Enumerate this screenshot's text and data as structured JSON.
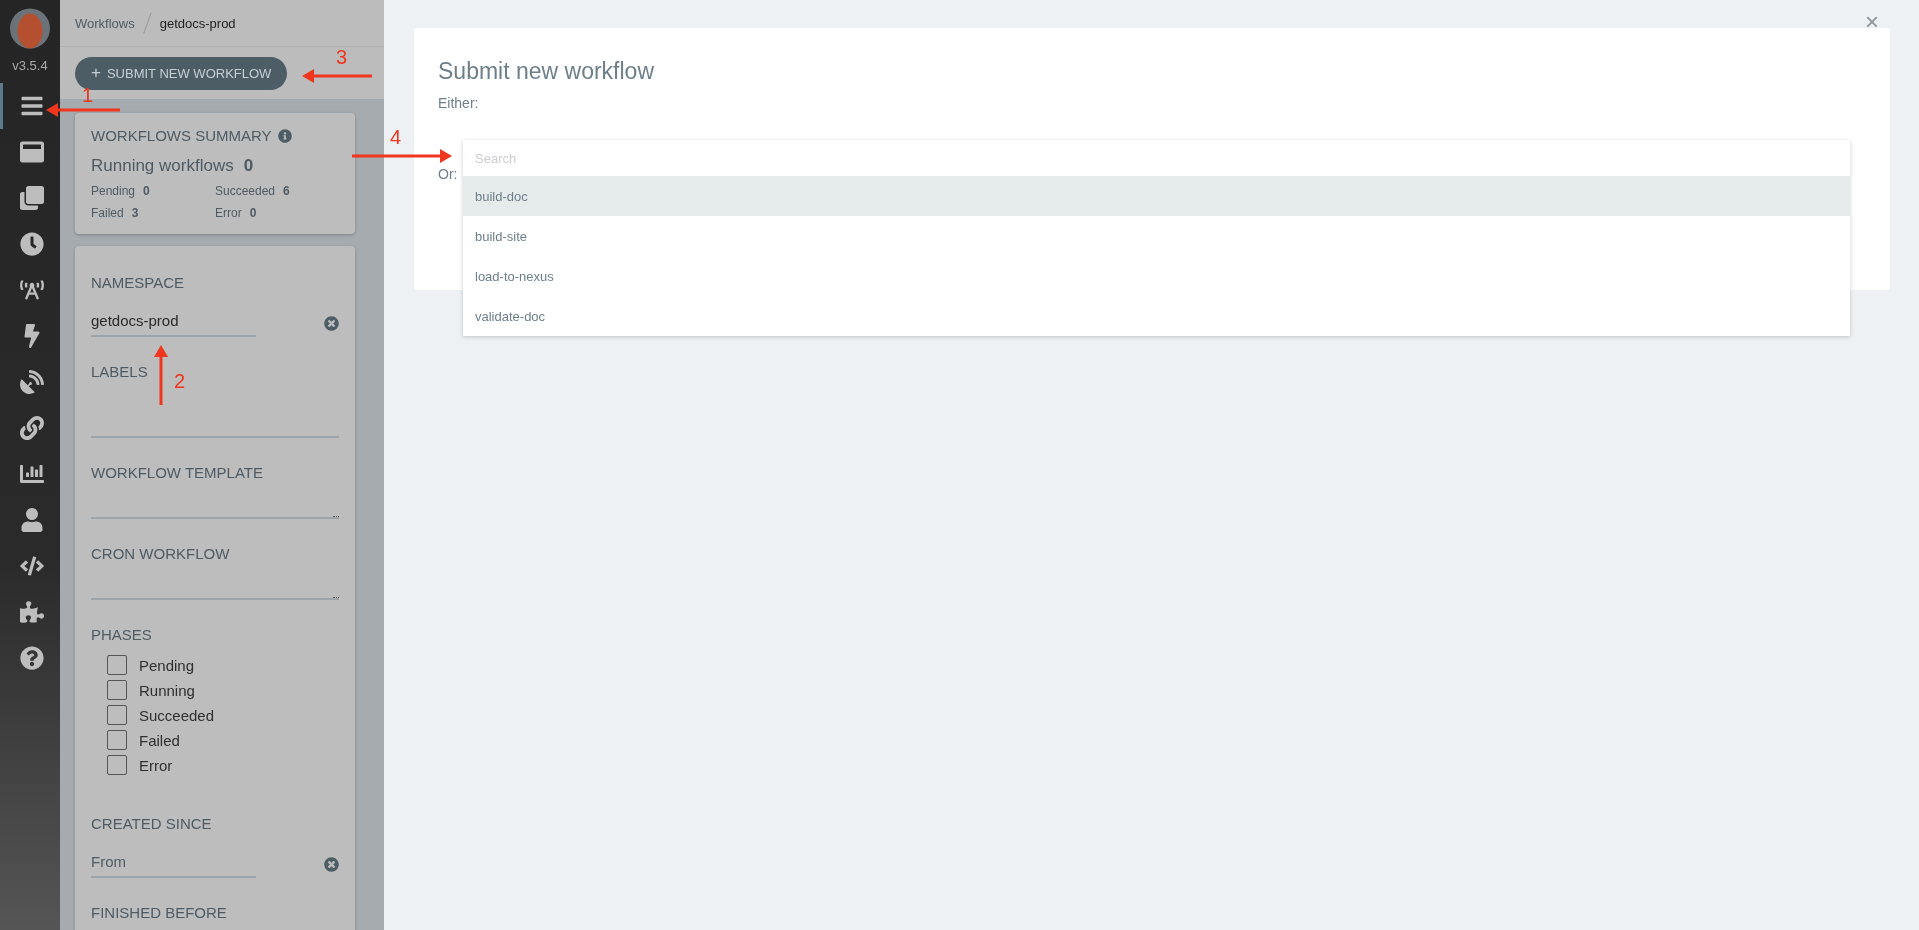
{
  "sidebar": {
    "version": "v3.5.4",
    "items": [
      {
        "selected": true
      },
      {
        "selected": false
      },
      {
        "selected": false
      },
      {
        "selected": false
      },
      {
        "selected": false
      },
      {
        "selected": false
      },
      {
        "selected": false
      },
      {
        "selected": false
      },
      {
        "selected": false
      },
      {
        "selected": false
      },
      {
        "selected": false
      },
      {
        "selected": false
      },
      {
        "selected": false
      }
    ]
  },
  "breadcrumb": [
    "Workflows",
    "getdocs-prod"
  ],
  "submit_button": {
    "icon": "+",
    "label": "SUBMIT NEW WORKFLOW"
  },
  "summary": {
    "title": "WORKFLOWS SUMMARY",
    "running_label": "Running workflows",
    "running_count": "0",
    "stats": [
      {
        "label": "Pending",
        "value": "0"
      },
      {
        "label": "Succeeded",
        "value": "6"
      },
      {
        "label": "Failed",
        "value": "3"
      },
      {
        "label": "Error",
        "value": "0"
      }
    ]
  },
  "filters": {
    "namespace": {
      "label": "NAMESPACE",
      "value": "getdocs-prod"
    },
    "labels": {
      "label": "LABELS"
    },
    "workflow_template": {
      "label": "WORKFLOW TEMPLATE"
    },
    "cron_workflow": {
      "label": "CRON WORKFLOW"
    },
    "phases": {
      "label": "PHASES",
      "options": [
        {
          "label": "Pending",
          "checked": false
        },
        {
          "label": "Running",
          "checked": false
        },
        {
          "label": "Succeeded",
          "checked": false
        },
        {
          "label": "Failed",
          "checked": false
        },
        {
          "label": "Error",
          "checked": false
        }
      ]
    },
    "created_since": {
      "label": "CREATED SINCE",
      "placeholder": "From"
    },
    "finished_before": {
      "label": "FINISHED BEFORE"
    }
  },
  "modal": {
    "close": "×",
    "title": "Submit new workflow",
    "either": "Either:",
    "or": "Or:",
    "dropdown": {
      "placeholder": "Search",
      "options": [
        {
          "label": "build-doc",
          "selected": true
        },
        {
          "label": "build-site",
          "selected": false
        },
        {
          "label": "load-to-nexus",
          "selected": false
        },
        {
          "label": "validate-doc",
          "selected": false
        }
      ]
    }
  },
  "annotations": [
    "1",
    "2",
    "3",
    "4"
  ]
}
